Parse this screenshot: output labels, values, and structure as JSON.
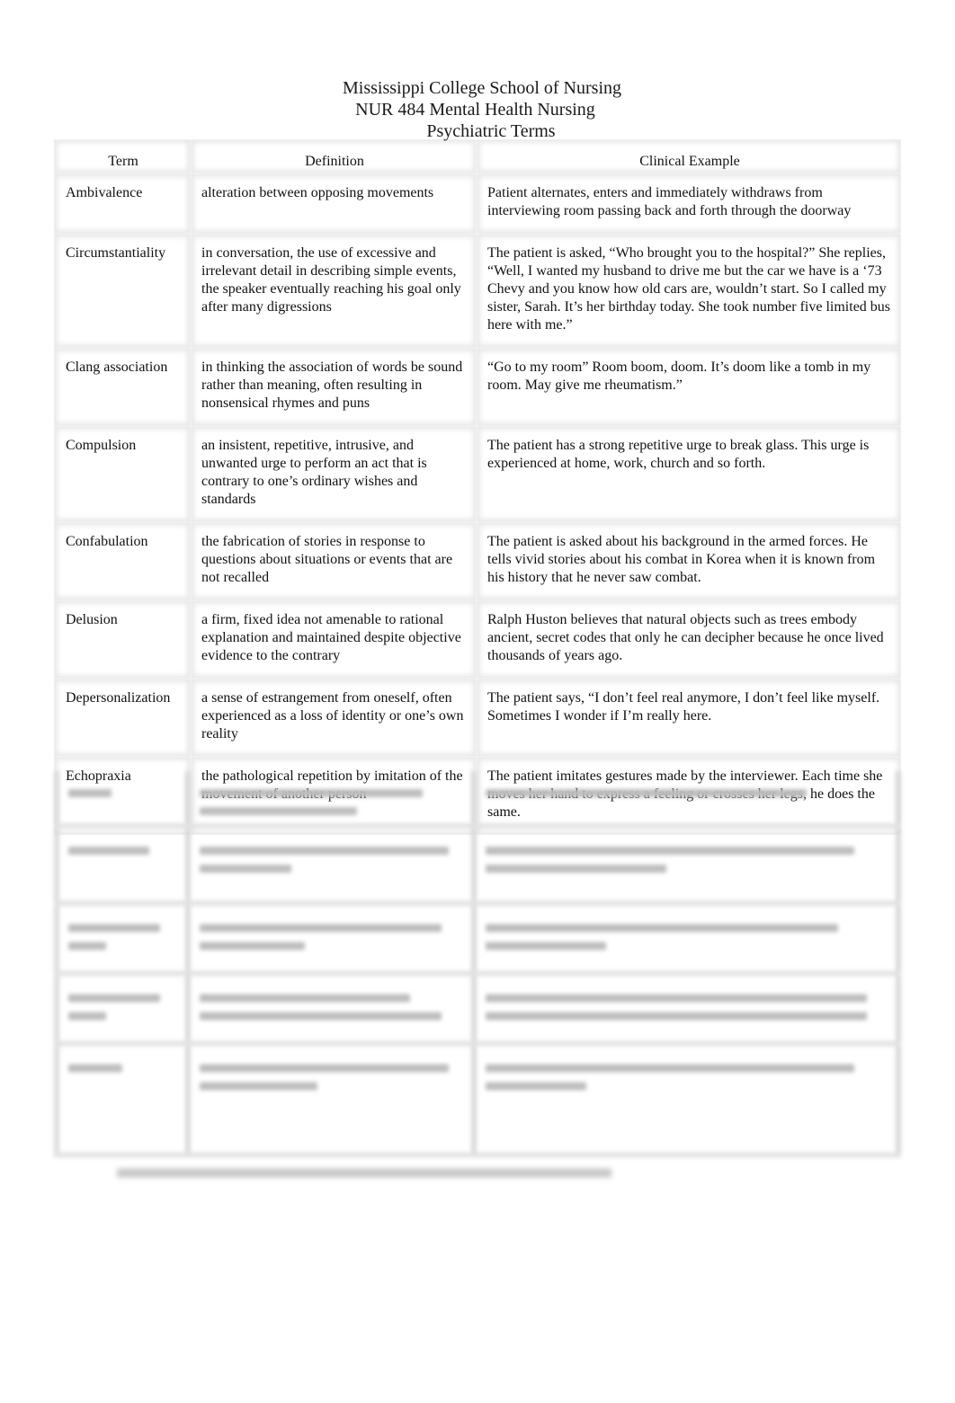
{
  "header": {
    "institution": "Mississippi College School of Nursing",
    "course": "NUR 484 Mental Health Nursing",
    "title": "Psychiatric Terms"
  },
  "table": {
    "columns": [
      "Term",
      "Definition",
      "Clinical Example"
    ],
    "rows": [
      {
        "term": "Ambivalence",
        "definition": "alteration between opposing movements",
        "example": "Patient alternates, enters and immediately withdraws from interviewing room passing back and forth through the doorway"
      },
      {
        "term": "Circumstantiality",
        "definition": "in conversation, the use of excessive and irrelevant detail in describing simple events, the speaker eventually reaching his goal only after many digressions",
        "example": "The patient is asked, “Who brought you to the hospital?”  She replies, “Well, I wanted my husband to drive me but the car we have is a ‘73 Chevy and you know how old cars are, wouldn’t start.  So I called my sister, Sarah.  It’s her birthday today.  She took number five limited bus here with me.”"
      },
      {
        "term": "Clang association",
        "definition": "in thinking the association of words be sound rather than meaning, often resulting in nonsensical rhymes and puns",
        "example": "“Go to my room” Room boom, doom.  It’s doom like a tomb in my room.  May give me rheumatism.”"
      },
      {
        "term": "Compulsion",
        "definition": "an insistent, repetitive, intrusive, and unwanted urge to perform an act that is contrary to one’s ordinary wishes and standards",
        "example": "The patient has a strong repetitive urge to break glass.  This urge is experienced at home, work, church and so forth."
      },
      {
        "term": "Confabulation",
        "definition": "the fabrication of stories in response to questions about situations or events that are not recalled",
        "example": "The patient is asked about his background in the armed forces.  He tells vivid stories about his combat in Korea when it is known from his history that he never saw combat."
      },
      {
        "term": "Delusion",
        "definition": "a firm, fixed idea not amenable to rational explanation and maintained despite objective evidence to the contrary",
        "example": "Ralph Huston believes that natural objects such as trees embody ancient, secret codes that only he can decipher because he once lived thousands of years ago."
      },
      {
        "term": "Depersonalization",
        "definition": "a sense of estrangement from oneself, often experienced as a loss of identity or one’s own reality",
        "example": "The patient says, “I don’t feel real anymore, I don’t feel like myself.  Sometimes I wonder if I’m really here."
      },
      {
        "term": "Echopraxia",
        "definition": "the pathological repetition by imitation of the movement of another person",
        "example": "The patient imitates gestures made by the interviewer.  Each time she moves her hand to express a feeling or crosses her legs, he does the same."
      }
    ]
  }
}
